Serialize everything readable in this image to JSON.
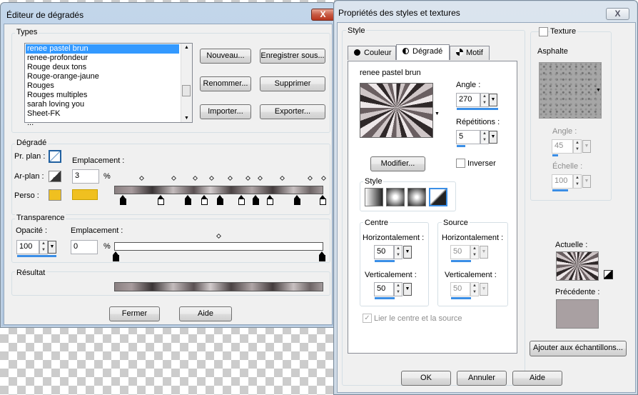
{
  "gradient_editor": {
    "title": "Éditeur de dégradés",
    "close_label": "X",
    "types_label": "Types",
    "types": [
      "renee pastel brun",
      "renee-profondeur",
      "Rouge deux tons",
      "Rouge-orange-jaune",
      "Rouges",
      "Rouges multiples",
      "sarah loving you",
      "Sheet-FK",
      "..."
    ],
    "buttons": {
      "new": "Nouveau...",
      "save_as": "Enregistrer sous...",
      "rename": "Renommer...",
      "delete": "Supprimer",
      "import": "Importer...",
      "export": "Exporter..."
    },
    "gradient_group": "Dégradé",
    "foreground_label": "Pr. plan :",
    "background_label": "Ar-plan :",
    "custom_label": "Perso :",
    "location_label": "Emplacement :",
    "location_value": "3",
    "percent": "%",
    "custom_color": "#f0c020",
    "transparency_group": "Transparence",
    "opacity_label": "Opacité :",
    "opacity_value": "100",
    "trans_location_label": "Emplacement :",
    "trans_location_value": "0",
    "result_group": "Résultat",
    "ok_label": "Fermer",
    "help_label": "Aide"
  },
  "style_props": {
    "title": "Propriétés des styles et textures",
    "close_label": "X",
    "style_group": "Style",
    "tabs": [
      {
        "label": "Couleur",
        "icon": "dot-icon"
      },
      {
        "label": "Dégradé",
        "icon": "half-circle-icon"
      },
      {
        "label": "Motif",
        "icon": "pattern-icon"
      }
    ],
    "gradient_name": "renee pastel brun",
    "angle_label": "Angle :",
    "angle_value": "270",
    "repeats_label": "Répétitions :",
    "repeats_value": "5",
    "modify_label": "Modifier...",
    "invert_label": "Inverser",
    "style_sub_label": "Style",
    "center_group": "Centre",
    "source_group": "Source",
    "horizontal_label": "Horizontalement :",
    "vertical_label": "Verticalement :",
    "center_h": "50",
    "center_v": "50",
    "source_h": "50",
    "source_v": "50",
    "link_label": "Lier le centre et la source",
    "texture_label": "Texture",
    "texture_name": "Asphalte",
    "tex_angle_label": "Angle :",
    "tex_angle_value": "45",
    "scale_label": "Échelle :",
    "scale_value": "100",
    "current_label": "Actuelle :",
    "previous_label": "Précédente :",
    "previous_color": "#a9a0a2",
    "add_swatch_label": "Ajouter aux échantillons...",
    "ok_label": "OK",
    "cancel_label": "Annuler",
    "help_label": "Aide"
  }
}
